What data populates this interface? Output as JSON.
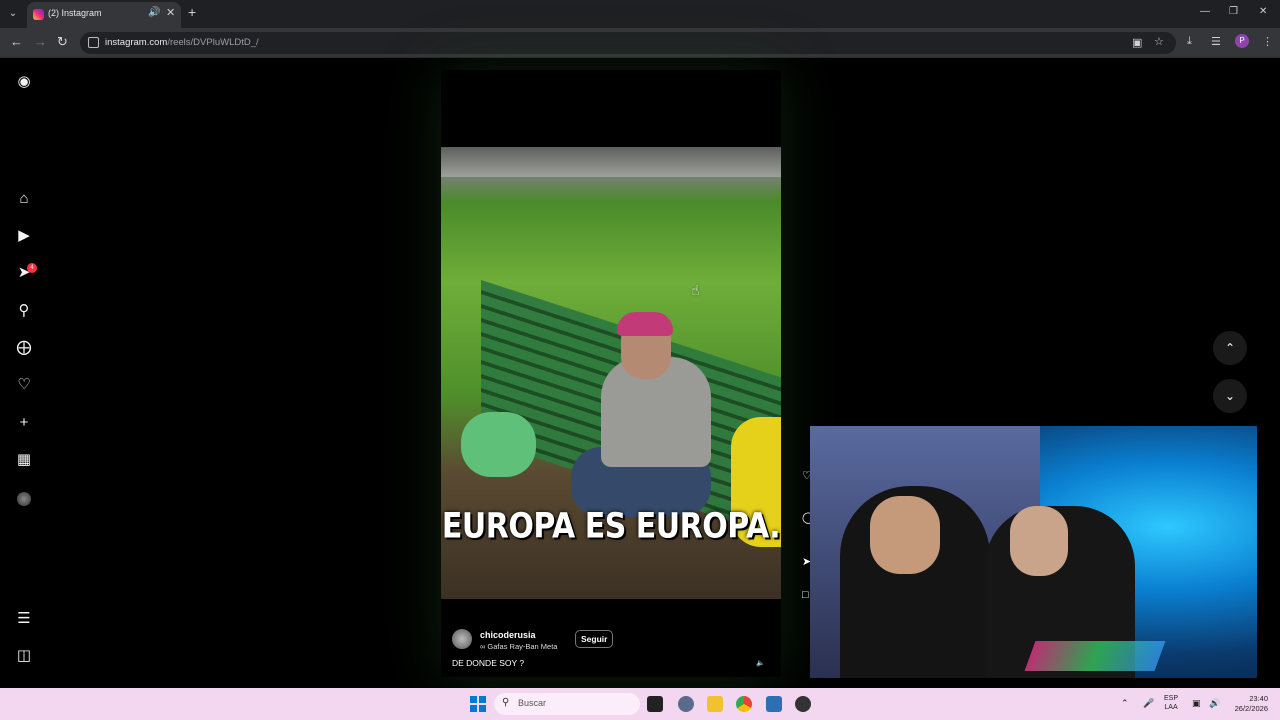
{
  "browser": {
    "tab_title": "(2) Instagram",
    "url_host": "instagram.com",
    "url_path": "/reels/DVPluWLDtD_/",
    "profile_initial": "P"
  },
  "sidebar": {
    "notification_count": "4",
    "items": [
      {
        "icon": "instagram-logo-icon"
      },
      {
        "icon": "home-icon"
      },
      {
        "icon": "reels-icon"
      },
      {
        "icon": "direct-messages-icon"
      },
      {
        "icon": "search-icon"
      },
      {
        "icon": "explore-icon"
      },
      {
        "icon": "notifications-heart-icon"
      },
      {
        "icon": "create-plus-icon"
      },
      {
        "icon": "dashboard-icon"
      },
      {
        "icon": "profile-avatar"
      },
      {
        "icon": "more-menu-icon"
      },
      {
        "icon": "also-from-meta-icon"
      }
    ]
  },
  "reel": {
    "overlay_caption": "EUROPA ES EUROPA.",
    "username": "chicoderusia",
    "subtitle": "∞ Gafas Ray-Ban Meta",
    "follow_label": "Seguir",
    "caption": "DE DONDE SOY ?"
  },
  "taskbar": {
    "search_placeholder": "Buscar",
    "lang_1": "ESP",
    "lang_2": "LAA",
    "time": "23:40",
    "date": "26/2/2026"
  }
}
